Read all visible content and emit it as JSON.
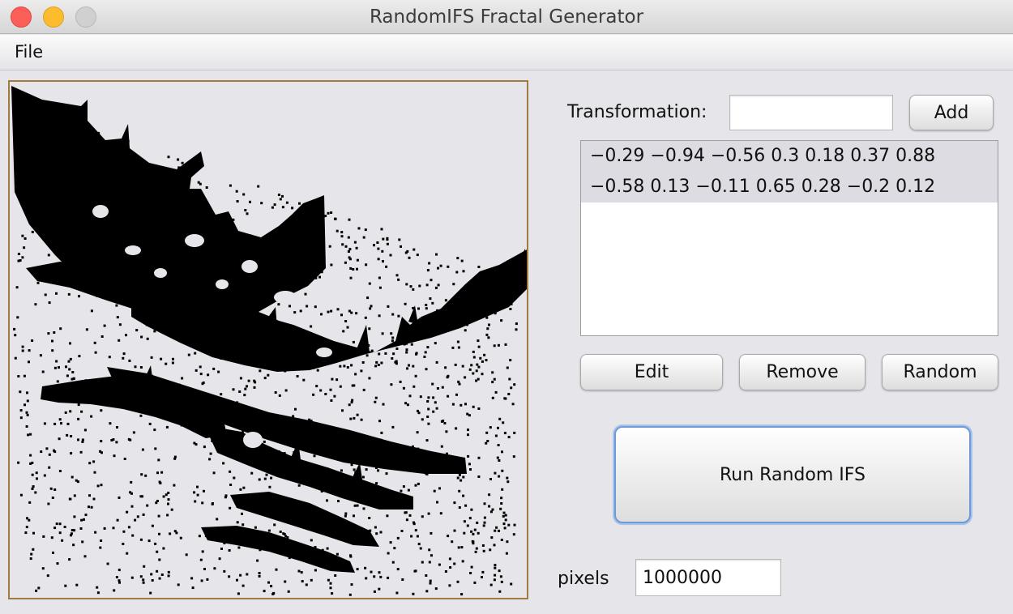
{
  "window": {
    "title": "RandomIFS Fractal Generator"
  },
  "menu": {
    "file": "File"
  },
  "transformation": {
    "label": "Transformation:",
    "value": "",
    "add_label": "Add"
  },
  "list": {
    "items": [
      "−0.29 −0.94 −0.56 0.3 0.18 0.37 0.88",
      "−0.58 0.13 −0.11 0.65 0.28 −0.2 0.12"
    ]
  },
  "buttons": {
    "edit": "Edit",
    "remove": "Remove",
    "random": "Random",
    "run": "Run Random IFS"
  },
  "pixels": {
    "label": "pixels",
    "value": "1000000"
  },
  "colors": {
    "fractal": "#000000",
    "canvas_border": "#a07a40",
    "run_focus": "#6d9ad6"
  }
}
